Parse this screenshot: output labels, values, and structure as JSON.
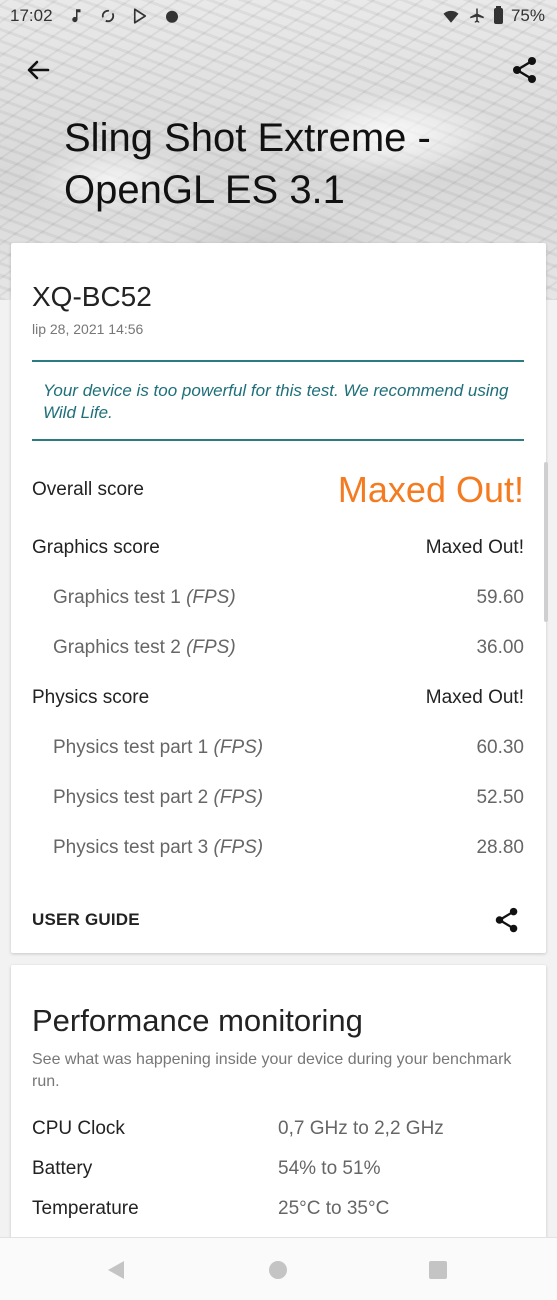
{
  "status_bar": {
    "time": "17:02",
    "icons_left": [
      "music-note-icon",
      "sync-icon",
      "play-store-icon",
      "app-icon"
    ],
    "icons_right": [
      "wifi-icon",
      "airplane-icon",
      "battery-icon"
    ],
    "battery": "75%"
  },
  "toolbar": {
    "back_icon": "arrow-left-icon",
    "share_icon": "share-icon"
  },
  "hero": {
    "title": "Sling Shot Extreme - OpenGL ES 3.1"
  },
  "result": {
    "device": "XQ-BC52",
    "date": "lip 28, 2021 14:56",
    "notice": "Your device is too powerful for this test. We recommend using Wild Life.",
    "overall": {
      "label": "Overall score",
      "value": "Maxed Out!"
    },
    "graphics": {
      "label": "Graphics score",
      "value": "Maxed Out!",
      "tests": [
        {
          "label": "Graphics test 1 ",
          "unit": "(FPS)",
          "value": "59.60"
        },
        {
          "label": "Graphics test 2 ",
          "unit": "(FPS)",
          "value": "36.00"
        }
      ]
    },
    "physics": {
      "label": "Physics score",
      "value": "Maxed Out!",
      "tests": [
        {
          "label": "Physics test part 1 ",
          "unit": "(FPS)",
          "value": "60.30"
        },
        {
          "label": "Physics test part 2 ",
          "unit": "(FPS)",
          "value": "52.50"
        },
        {
          "label": "Physics test part 3 ",
          "unit": "(FPS)",
          "value": "28.80"
        }
      ]
    },
    "user_guide": "USER GUIDE"
  },
  "performance": {
    "title": "Performance monitoring",
    "description": "See what was happening inside your device during your benchmark run.",
    "rows": [
      {
        "key": "CPU Clock",
        "value": "0,7 GHz to 2,2 GHz"
      },
      {
        "key": "Battery",
        "value": "54% to 51%"
      },
      {
        "key": "Temperature",
        "value": "25°C to 35°C"
      }
    ]
  },
  "colors": {
    "accent_teal": "#2a7b82",
    "maxed_orange": "#f47b20"
  }
}
